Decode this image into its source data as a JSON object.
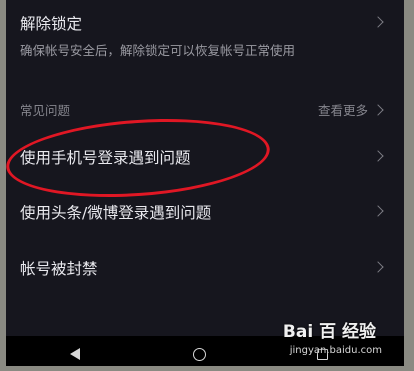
{
  "unlock": {
    "title": "解除锁定",
    "subtitle": "确保帐号安全后，解除锁定可以恢复帐号正常使用"
  },
  "faq": {
    "header": "常见问题",
    "more_label": "查看更多",
    "items": [
      {
        "label": "使用手机号登录遇到问题"
      },
      {
        "label": "使用头条/微博登录遇到问题"
      },
      {
        "label": "帐号被封禁"
      }
    ]
  },
  "annotation": {
    "circle_color": "#e01724"
  },
  "watermark": {
    "brand": "Bai 百 经验",
    "url": "jingyan.baidu.com"
  },
  "icons": [
    "chevron-right-icon",
    "nav-back-icon",
    "nav-home-icon",
    "nav-recents-icon",
    "baidu-paw-icon"
  ]
}
